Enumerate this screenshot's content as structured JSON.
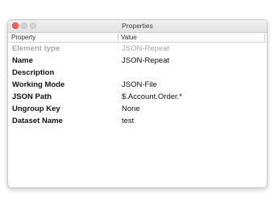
{
  "window": {
    "title": "Properties"
  },
  "table": {
    "columns": [
      "Property",
      "Value"
    ],
    "rows": [
      {
        "property": "Element type",
        "value": "JSON-Repeat",
        "disabled": true
      },
      {
        "property": "Name",
        "value": "JSON-Repeat",
        "disabled": false
      },
      {
        "property": "Description",
        "value": "",
        "disabled": false
      },
      {
        "property": "Working Mode",
        "value": "JSON-File",
        "disabled": false
      },
      {
        "property": "JSON Path",
        "value": "$.Account.Order.*",
        "disabled": false
      },
      {
        "property": "Ungroup Key",
        "value": "None",
        "disabled": false
      },
      {
        "property": "Dataset Name",
        "value": "test",
        "disabled": false
      }
    ]
  },
  "colors": {
    "close_button": "#ff5f57",
    "disabled_text": "#a9a9a9"
  }
}
